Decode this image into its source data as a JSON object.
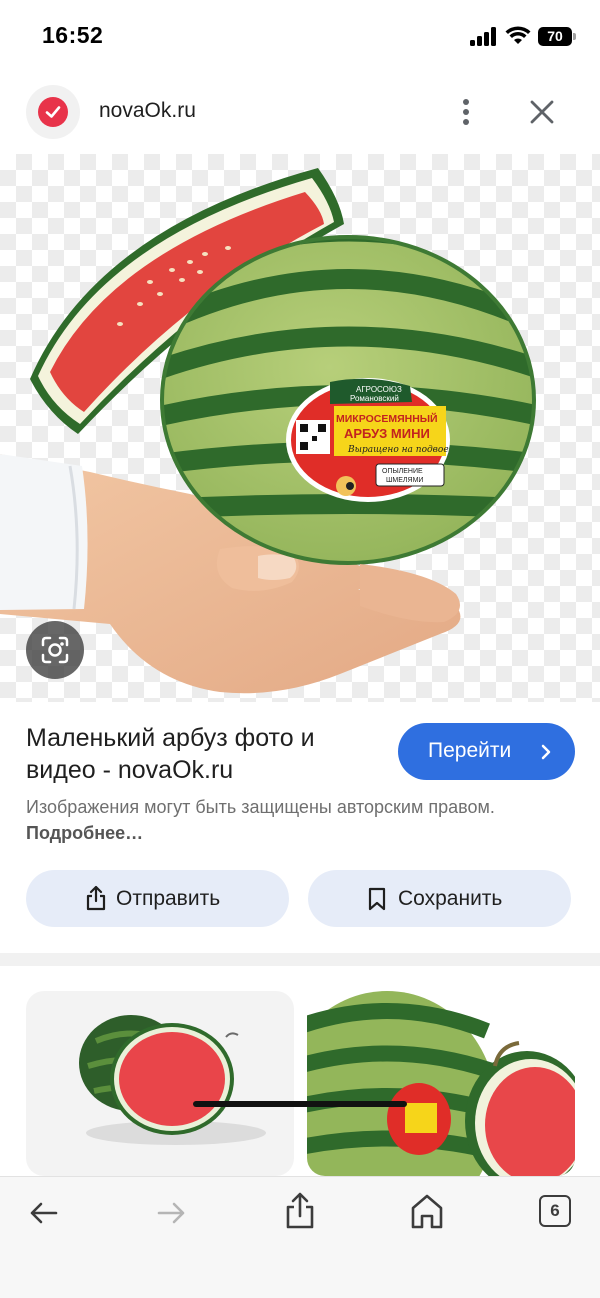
{
  "status_bar": {
    "time": "16:52",
    "battery": "70"
  },
  "source": {
    "name": "novaOk.ru"
  },
  "image": {
    "label_brand_line1": "АГРОСОЮЗ",
    "label_brand_line2": "Романовский",
    "label_title_line1": "МИКРОСЕМЯННЫЙ",
    "label_title_line2": "АРБУЗ МИНИ",
    "label_script": "Выращено на подвое",
    "label_badge_line1": "ОПЫЛЕНИЕ",
    "label_badge_line2": "ШМЕЛЯМИ"
  },
  "result": {
    "title": "Маленький арбуз фото и видео - novaOk.ru",
    "visit_label": "Перейти",
    "copyright_text": "Изображения могут быть защищены авторским правом.",
    "copyright_more": "Подробнее…"
  },
  "actions": {
    "share_label": "Отправить",
    "save_label": "Сохранить"
  },
  "toolbar": {
    "tabs_count": "6"
  },
  "colors": {
    "accent": "#2f6fe0",
    "action_bg": "#e6ecf8",
    "favicon": "#e8334a"
  }
}
